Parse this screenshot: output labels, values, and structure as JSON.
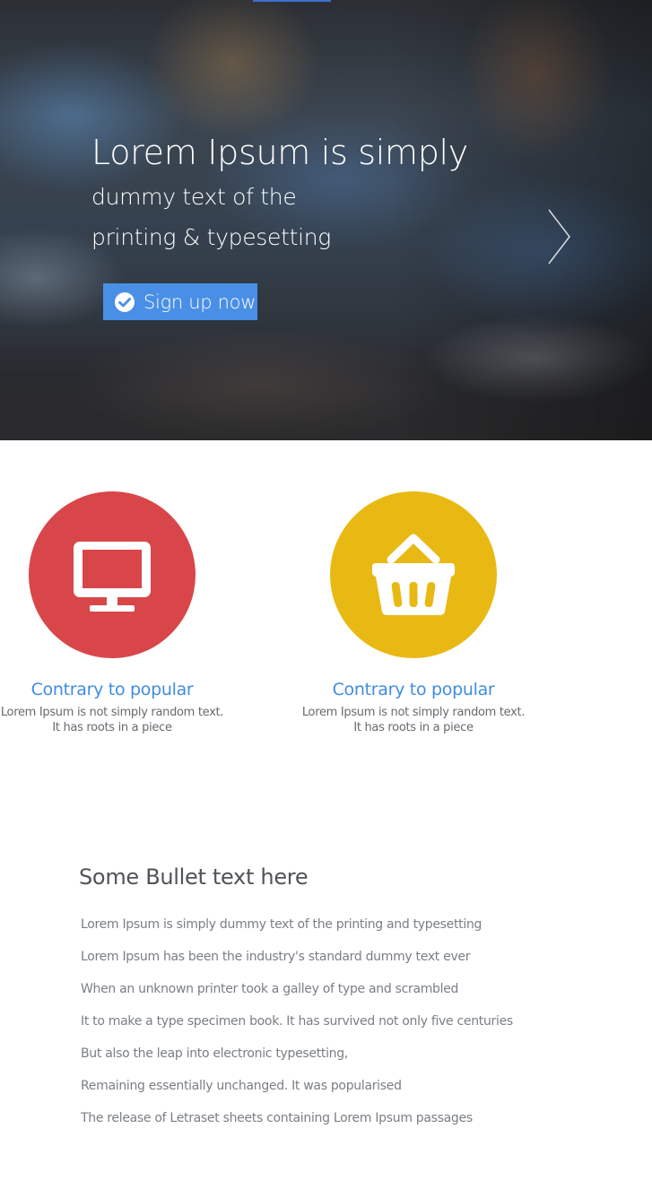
{
  "hero": {
    "title": "Lorem Ipsum is simply",
    "subtitle_line1": "dummy text of the",
    "subtitle_line2": "printing & typesetting",
    "cta_label": "Sign up now",
    "accent_color": "#4a8fe6"
  },
  "features": [
    {
      "icon": "monitor-icon",
      "color": "#d9464a",
      "title": "Contrary to popular",
      "desc_line1": "Lorem Ipsum is not simply random text.",
      "desc_line2": "It has roots in a piece"
    },
    {
      "icon": "basket-icon",
      "color": "#e9b913",
      "title": "Contrary to popular",
      "desc_line1": "Lorem Ipsum is not simply random text.",
      "desc_line2": "It has roots in a piece"
    }
  ],
  "bullets": {
    "title": "Some Bullet text here",
    "items": [
      "Lorem Ipsum is simply dummy text of the printing and typesetting",
      "Lorem Ipsum has been the industry's standard dummy text ever",
      "When an unknown printer took a galley of type and scrambled",
      "It to make a type specimen book. It has survived not only five centuries",
      "But also the leap into electronic typesetting,",
      "Remaining essentially unchanged. It was popularised",
      "The release of Letraset sheets containing Lorem Ipsum passages"
    ]
  }
}
